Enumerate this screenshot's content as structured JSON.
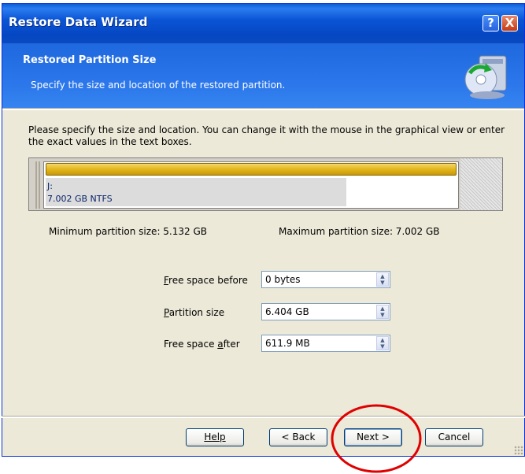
{
  "window": {
    "title": "Restore Data Wizard",
    "help_button": "?",
    "close_button": "X"
  },
  "header": {
    "title": "Restored Partition Size",
    "subtitle": "Specify the size and location of the restored partition."
  },
  "instructions": "Please specify the size and location. You can change it with the mouse in the graphical view or enter the exact values in the text boxes.",
  "partition": {
    "drive_label": "J:",
    "size_fs_label": "7.002 GB  NTFS",
    "used_fraction": 0.73
  },
  "limits": {
    "min_label": "Minimum partition size:  5.132 GB",
    "max_label": "Maximum partition size:  7.002 GB"
  },
  "fields": {
    "free_before": {
      "label": "Free space before",
      "value": "0 bytes"
    },
    "partition_size": {
      "label": "Partition size",
      "value": "6.404 GB"
    },
    "free_after": {
      "label": "Free space after",
      "value": "611.9 MB"
    }
  },
  "buttons": {
    "help": "Help",
    "back": "< Back",
    "next": "Next >",
    "cancel": "Cancel"
  },
  "colors": {
    "titlebar": "#0a55d6",
    "partition_bar": "#e0b317",
    "annotation_circle": "#e00000"
  }
}
